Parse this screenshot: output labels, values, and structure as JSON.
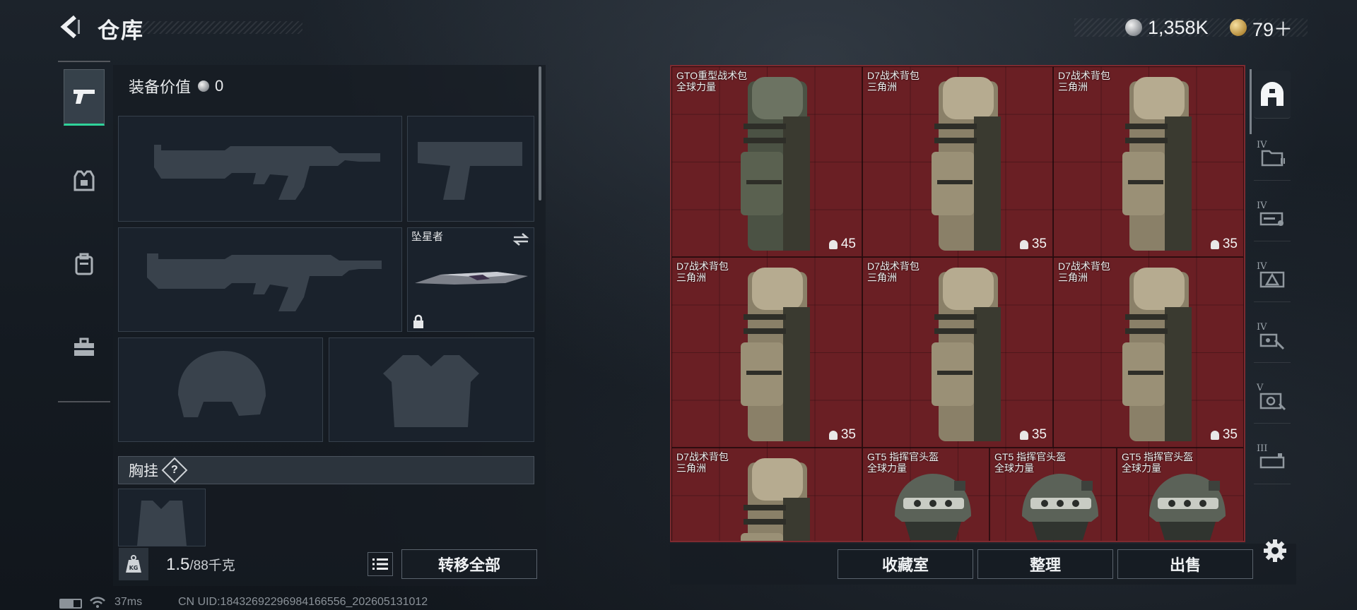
{
  "header": {
    "title": "仓库",
    "currency_silver": "1,358K",
    "currency_gold": "79＋"
  },
  "categories": [
    {
      "icon": "pistol-icon",
      "active": true
    },
    {
      "icon": "armor-vest-icon",
      "active": false
    },
    {
      "icon": "backpack-icon",
      "active": false
    },
    {
      "icon": "toolbox-icon",
      "active": false
    }
  ],
  "loadout": {
    "equip_value_label": "装备价值",
    "equip_value": "0",
    "melee_name": "坠星者",
    "chest_rig_label": "胸挂",
    "help_mark": "?"
  },
  "bottom": {
    "weight_current": "1.5",
    "weight_max": "/88千克",
    "transfer_all": "转移全部",
    "collection": "收藏室",
    "organize": "整理",
    "sell": "出售"
  },
  "stash_items": [
    {
      "name": "GTO重型战术包",
      "origin": "全球力量",
      "capacity": "45",
      "kind": "heavy-backpack"
    },
    {
      "name": "D7战术背包",
      "origin": "三角洲",
      "capacity": "35",
      "kind": "backpack"
    },
    {
      "name": "D7战术背包",
      "origin": "三角洲",
      "capacity": "35",
      "kind": "backpack"
    },
    {
      "name": "D7战术背包",
      "origin": "三角洲",
      "capacity": "35",
      "kind": "backpack"
    },
    {
      "name": "D7战术背包",
      "origin": "三角洲",
      "capacity": "35",
      "kind": "backpack"
    },
    {
      "name": "D7战术背包",
      "origin": "三角洲",
      "capacity": "35",
      "kind": "backpack"
    },
    {
      "name": "D7战术背包",
      "origin": "三角洲",
      "capacity": "",
      "kind": "backpack"
    },
    {
      "name": "GT5 指挥官头盔",
      "origin": "全球力量",
      "capacity": "",
      "kind": "helmet"
    },
    {
      "name": "GT5 指挥官头盔",
      "origin": "全球力量",
      "capacity": "",
      "kind": "helmet"
    },
    {
      "name": "GT5 指挥官头盔",
      "origin": "全球力量",
      "capacity": "",
      "kind": "helmet"
    }
  ],
  "filters": [
    {
      "icon": "stash-all-icon",
      "tier": ""
    },
    {
      "icon": "folder-icon",
      "tier": "IV"
    },
    {
      "icon": "key-card-icon",
      "tier": "IV"
    },
    {
      "icon": "warning-triangle-icon",
      "tier": "IV"
    },
    {
      "icon": "medical-tool-icon",
      "tier": "IV"
    },
    {
      "icon": "ammo-box-icon",
      "tier": "V"
    },
    {
      "icon": "crate-icon",
      "tier": "III"
    }
  ],
  "status": {
    "ping": "37ms",
    "uid": "CN UID:18432692296984166556_202605131012"
  },
  "colors": {
    "accent_green": "#2fd39a",
    "stash_red": "#6a1f24"
  }
}
